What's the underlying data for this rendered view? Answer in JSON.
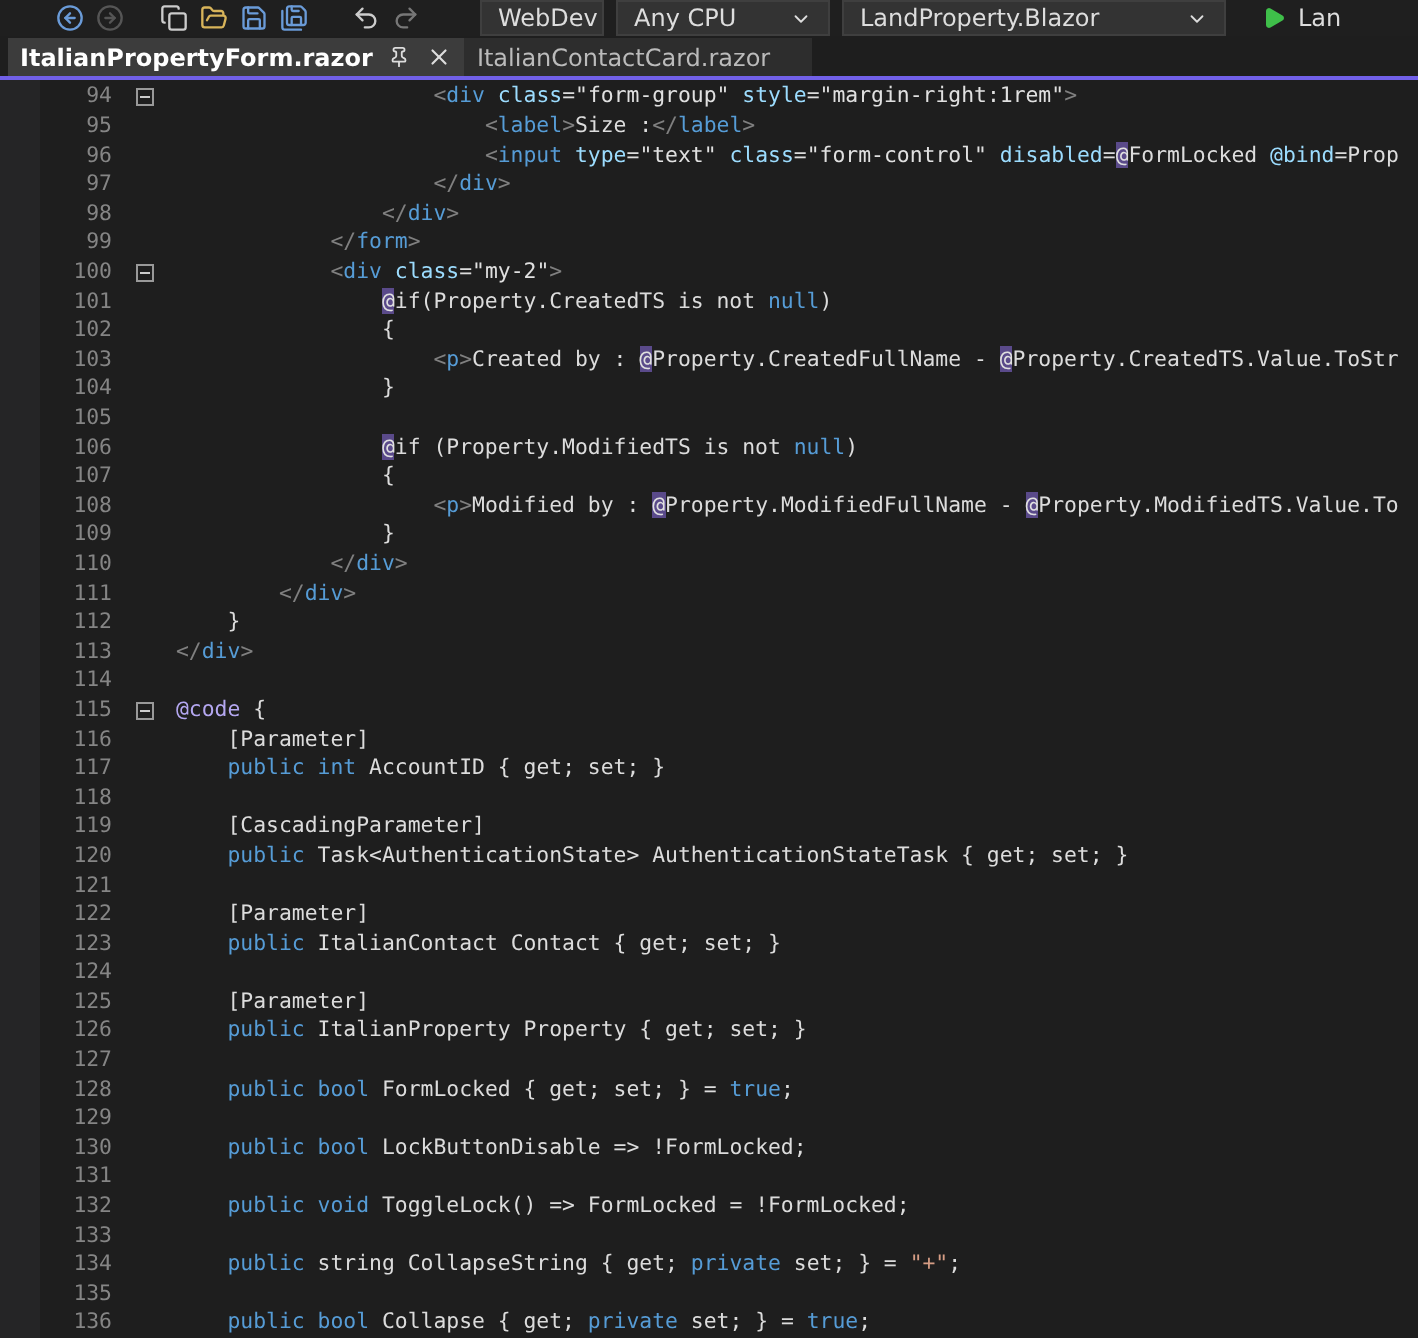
{
  "toolbar": {
    "dropdowns": [
      {
        "label": "WebDev"
      },
      {
        "label": "Any CPU"
      },
      {
        "label": "LandProperty.Blazor"
      }
    ],
    "run_label": "Lan"
  },
  "tabs": [
    {
      "label": "ItalianPropertyForm.razor",
      "selected": true
    },
    {
      "label": "ItalianContactCard.razor",
      "selected": false
    }
  ],
  "lines": [
    {
      "number": "94",
      "fold": true,
      "tokens": [
        {
          "text": "                    <",
          "kind": "punct"
        },
        {
          "text": "div",
          "kind": "tag"
        },
        {
          "text": " class",
          "kind": "attr"
        },
        {
          "text": "=",
          "kind": "text"
        },
        {
          "text": "\"form-group\"",
          "kind": "str"
        },
        {
          "text": " style",
          "kind": "attr"
        },
        {
          "text": "=",
          "kind": "text"
        },
        {
          "text": "\"margin-right:1rem\"",
          "kind": "str"
        },
        {
          "text": ">",
          "kind": "punct"
        }
      ]
    },
    {
      "number": "95",
      "fold": false,
      "tokens": [
        {
          "text": "                        <",
          "kind": "punct"
        },
        {
          "text": "label",
          "kind": "tag"
        },
        {
          "text": ">",
          "kind": "punct"
        },
        {
          "text": "Size :",
          "kind": "text"
        },
        {
          "text": "</",
          "kind": "punct"
        },
        {
          "text": "label",
          "kind": "tag"
        },
        {
          "text": ">",
          "kind": "punct"
        }
      ]
    },
    {
      "number": "96",
      "fold": false,
      "tokens": [
        {
          "text": "                        <",
          "kind": "punct"
        },
        {
          "text": "input",
          "kind": "tag"
        },
        {
          "text": " type",
          "kind": "attr"
        },
        {
          "text": "=",
          "kind": "text"
        },
        {
          "text": "\"text\"",
          "kind": "str"
        },
        {
          "text": " class",
          "kind": "attr"
        },
        {
          "text": "=",
          "kind": "text"
        },
        {
          "text": "\"form-control\"",
          "kind": "str"
        },
        {
          "text": " disabled",
          "kind": "attr"
        },
        {
          "text": "=",
          "kind": "text"
        },
        {
          "text": "@",
          "kind": "at"
        },
        {
          "text": "FormLocked ",
          "kind": "text"
        },
        {
          "text": "@bind",
          "kind": "attr"
        },
        {
          "text": "=Prop",
          "kind": "text"
        }
      ]
    },
    {
      "number": "97",
      "fold": false,
      "tokens": [
        {
          "text": "                    </",
          "kind": "punct"
        },
        {
          "text": "div",
          "kind": "tag"
        },
        {
          "text": ">",
          "kind": "punct"
        }
      ]
    },
    {
      "number": "98",
      "fold": false,
      "tokens": [
        {
          "text": "                </",
          "kind": "punct"
        },
        {
          "text": "div",
          "kind": "tag"
        },
        {
          "text": ">",
          "kind": "punct"
        }
      ]
    },
    {
      "number": "99",
      "fold": false,
      "tokens": [
        {
          "text": "            </",
          "kind": "punct"
        },
        {
          "text": "form",
          "kind": "tag"
        },
        {
          "text": ">",
          "kind": "punct"
        }
      ]
    },
    {
      "number": "100",
      "fold": true,
      "tokens": [
        {
          "text": "            <",
          "kind": "punct"
        },
        {
          "text": "div",
          "kind": "tag"
        },
        {
          "text": " class",
          "kind": "attr"
        },
        {
          "text": "=",
          "kind": "text"
        },
        {
          "text": "\"my-2\"",
          "kind": "str"
        },
        {
          "text": ">",
          "kind": "punct"
        }
      ]
    },
    {
      "number": "101",
      "fold": false,
      "tokens": [
        {
          "text": "                @",
          "kind": "at"
        },
        {
          "text": "if(Property.CreatedTS is not ",
          "kind": "text"
        },
        {
          "text": "null",
          "kind": "kw"
        },
        {
          "text": ")",
          "kind": "text"
        }
      ]
    },
    {
      "number": "102",
      "fold": false,
      "tokens": [
        {
          "text": "                {",
          "kind": "text"
        }
      ]
    },
    {
      "number": "103",
      "fold": false,
      "tokens": [
        {
          "text": "                    <",
          "kind": "punct"
        },
        {
          "text": "p",
          "kind": "tag"
        },
        {
          "text": ">",
          "kind": "punct"
        },
        {
          "text": "Created by : ",
          "kind": "text"
        },
        {
          "text": "@",
          "kind": "at"
        },
        {
          "text": "Property.CreatedFullName - ",
          "kind": "text"
        },
        {
          "text": "@",
          "kind": "at"
        },
        {
          "text": "Property.CreatedTS.Value.ToStr",
          "kind": "text"
        }
      ]
    },
    {
      "number": "104",
      "fold": false,
      "tokens": [
        {
          "text": "                }",
          "kind": "text"
        }
      ]
    },
    {
      "number": "105",
      "fold": false
    },
    {
      "number": "106",
      "fold": false,
      "tokens": [
        {
          "text": "                @",
          "kind": "at"
        },
        {
          "text": "if (Property.ModifiedTS is not ",
          "kind": "text"
        },
        {
          "text": "null",
          "kind": "kw"
        },
        {
          "text": ")",
          "kind": "text"
        }
      ]
    },
    {
      "number": "107",
      "fold": false,
      "tokens": [
        {
          "text": "                {",
          "kind": "text"
        }
      ]
    },
    {
      "number": "108",
      "fold": false,
      "tokens": [
        {
          "text": "                    <",
          "kind": "punct"
        },
        {
          "text": "p",
          "kind": "tag"
        },
        {
          "text": ">",
          "kind": "punct"
        },
        {
          "text": "Modified by : ",
          "kind": "text"
        },
        {
          "text": "@",
          "kind": "at"
        },
        {
          "text": "Property.ModifiedFullName - ",
          "kind": "text"
        },
        {
          "text": "@",
          "kind": "at"
        },
        {
          "text": "Property.ModifiedTS.Value.To",
          "kind": "text"
        }
      ]
    },
    {
      "number": "109",
      "fold": false,
      "tokens": [
        {
          "text": "                }",
          "kind": "text"
        }
      ]
    },
    {
      "number": "110",
      "fold": false,
      "tokens": [
        {
          "text": "            </",
          "kind": "punct"
        },
        {
          "text": "div",
          "kind": "tag"
        },
        {
          "text": ">",
          "kind": "punct"
        }
      ]
    },
    {
      "number": "111",
      "fold": false,
      "tokens": [
        {
          "text": "        </",
          "kind": "punct"
        },
        {
          "text": "div",
          "kind": "tag"
        },
        {
          "text": ">",
          "kind": "punct"
        }
      ]
    },
    {
      "number": "112",
      "fold": false,
      "tokens": [
        {
          "text": "    }",
          "kind": "text"
        }
      ]
    },
    {
      "number": "113",
      "fold": false,
      "tokens": [
        {
          "text": "</",
          "kind": "punct"
        },
        {
          "text": "div",
          "kind": "tag"
        },
        {
          "text": ">",
          "kind": "punct"
        }
      ]
    },
    {
      "number": "114",
      "fold": false
    },
    {
      "number": "115",
      "fold": true,
      "tokens": [
        {
          "text": "@code",
          "kind": "directive"
        },
        {
          "text": " {",
          "kind": "text"
        }
      ]
    },
    {
      "number": "116",
      "fold": false,
      "tokens": [
        {
          "text": "    [Parameter]",
          "kind": "text"
        }
      ]
    },
    {
      "number": "117",
      "fold": false,
      "tokens": [
        {
          "text": "    public int",
          "kind": "kw"
        },
        {
          "text": " AccountID { get; set; }",
          "kind": "text"
        }
      ]
    },
    {
      "number": "118",
      "fold": false
    },
    {
      "number": "119",
      "fold": false,
      "tokens": [
        {
          "text": "    [CascadingParameter]",
          "kind": "text"
        }
      ]
    },
    {
      "number": "120",
      "fold": false,
      "tokens": [
        {
          "text": "    public",
          "kind": "kw"
        },
        {
          "text": " Task<AuthenticationState> AuthenticationStateTask { get; set; }",
          "kind": "text"
        }
      ]
    },
    {
      "number": "121",
      "fold": false
    },
    {
      "number": "122",
      "fold": false,
      "tokens": [
        {
          "text": "    [Parameter]",
          "kind": "text"
        }
      ]
    },
    {
      "number": "123",
      "fold": false,
      "tokens": [
        {
          "text": "    public",
          "kind": "kw"
        },
        {
          "text": " ItalianContact Contact { get; set; }",
          "kind": "text"
        }
      ]
    },
    {
      "number": "124",
      "fold": false
    },
    {
      "number": "125",
      "fold": false,
      "tokens": [
        {
          "text": "    [Parameter]",
          "kind": "text"
        }
      ]
    },
    {
      "number": "126",
      "fold": false,
      "tokens": [
        {
          "text": "    public",
          "kind": "kw"
        },
        {
          "text": " ItalianProperty Property { get; set; }",
          "kind": "text"
        }
      ]
    },
    {
      "number": "127",
      "fold": false
    },
    {
      "number": "128",
      "fold": false,
      "tokens": [
        {
          "text": "    public bool",
          "kind": "kw"
        },
        {
          "text": " FormLocked { get; set; } = ",
          "kind": "text"
        },
        {
          "text": "true",
          "kind": "kw"
        },
        {
          "text": ";",
          "kind": "text"
        }
      ]
    },
    {
      "number": "129",
      "fold": false
    },
    {
      "number": "130",
      "fold": false,
      "tokens": [
        {
          "text": "    public bool",
          "kind": "kw"
        },
        {
          "text": " LockButtonDisable => !FormLocked;",
          "kind": "text"
        }
      ]
    },
    {
      "number": "131",
      "fold": false
    },
    {
      "number": "132",
      "fold": false,
      "tokens": [
        {
          "text": "    public void",
          "kind": "kw"
        },
        {
          "text": " ToggleLock() => FormLocked = !FormLocked;",
          "kind": "text"
        }
      ]
    },
    {
      "number": "133",
      "fold": false
    },
    {
      "number": "134",
      "fold": false,
      "tokens": [
        {
          "text": "    public",
          "kind": "kw"
        },
        {
          "text": " string CollapseString { get; ",
          "kind": "text"
        },
        {
          "text": "private",
          "kind": "kw"
        },
        {
          "text": " set; } = ",
          "kind": "text"
        },
        {
          "text": "\"+\"",
          "kind": "string"
        },
        {
          "text": ";",
          "kind": "text"
        }
      ]
    },
    {
      "number": "135",
      "fold": false
    },
    {
      "number": "136",
      "fold": false,
      "tokens": [
        {
          "text": "    public bool",
          "kind": "kw"
        },
        {
          "text": " Collapse { get; ",
          "kind": "text"
        },
        {
          "text": "private",
          "kind": "kw"
        },
        {
          "text": " set; } = ",
          "kind": "text"
        },
        {
          "text": "true",
          "kind": "kw"
        },
        {
          "text": ";",
          "kind": "text"
        }
      ]
    }
  ]
}
